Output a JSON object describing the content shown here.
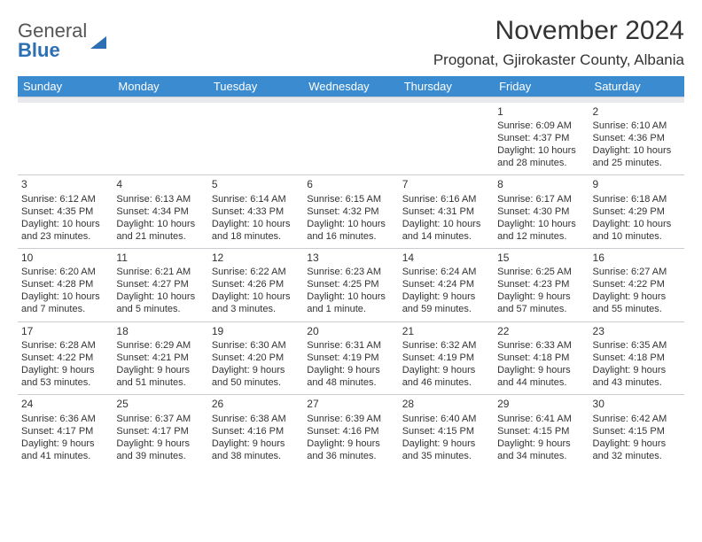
{
  "logo": {
    "top": "General",
    "bottom": "Blue"
  },
  "title": "November 2024",
  "location": "Progonat, Gjirokaster County, Albania",
  "weekdays": [
    "Sunday",
    "Monday",
    "Tuesday",
    "Wednesday",
    "Thursday",
    "Friday",
    "Saturday"
  ],
  "weeks": [
    [
      null,
      null,
      null,
      null,
      null,
      {
        "n": "1",
        "sr": "Sunrise: 6:09 AM",
        "ss": "Sunset: 4:37 PM",
        "d1": "Daylight: 10 hours",
        "d2": "and 28 minutes."
      },
      {
        "n": "2",
        "sr": "Sunrise: 6:10 AM",
        "ss": "Sunset: 4:36 PM",
        "d1": "Daylight: 10 hours",
        "d2": "and 25 minutes."
      }
    ],
    [
      {
        "n": "3",
        "sr": "Sunrise: 6:12 AM",
        "ss": "Sunset: 4:35 PM",
        "d1": "Daylight: 10 hours",
        "d2": "and 23 minutes."
      },
      {
        "n": "4",
        "sr": "Sunrise: 6:13 AM",
        "ss": "Sunset: 4:34 PM",
        "d1": "Daylight: 10 hours",
        "d2": "and 21 minutes."
      },
      {
        "n": "5",
        "sr": "Sunrise: 6:14 AM",
        "ss": "Sunset: 4:33 PM",
        "d1": "Daylight: 10 hours",
        "d2": "and 18 minutes."
      },
      {
        "n": "6",
        "sr": "Sunrise: 6:15 AM",
        "ss": "Sunset: 4:32 PM",
        "d1": "Daylight: 10 hours",
        "d2": "and 16 minutes."
      },
      {
        "n": "7",
        "sr": "Sunrise: 6:16 AM",
        "ss": "Sunset: 4:31 PM",
        "d1": "Daylight: 10 hours",
        "d2": "and 14 minutes."
      },
      {
        "n": "8",
        "sr": "Sunrise: 6:17 AM",
        "ss": "Sunset: 4:30 PM",
        "d1": "Daylight: 10 hours",
        "d2": "and 12 minutes."
      },
      {
        "n": "9",
        "sr": "Sunrise: 6:18 AM",
        "ss": "Sunset: 4:29 PM",
        "d1": "Daylight: 10 hours",
        "d2": "and 10 minutes."
      }
    ],
    [
      {
        "n": "10",
        "sr": "Sunrise: 6:20 AM",
        "ss": "Sunset: 4:28 PM",
        "d1": "Daylight: 10 hours",
        "d2": "and 7 minutes."
      },
      {
        "n": "11",
        "sr": "Sunrise: 6:21 AM",
        "ss": "Sunset: 4:27 PM",
        "d1": "Daylight: 10 hours",
        "d2": "and 5 minutes."
      },
      {
        "n": "12",
        "sr": "Sunrise: 6:22 AM",
        "ss": "Sunset: 4:26 PM",
        "d1": "Daylight: 10 hours",
        "d2": "and 3 minutes."
      },
      {
        "n": "13",
        "sr": "Sunrise: 6:23 AM",
        "ss": "Sunset: 4:25 PM",
        "d1": "Daylight: 10 hours",
        "d2": "and 1 minute."
      },
      {
        "n": "14",
        "sr": "Sunrise: 6:24 AM",
        "ss": "Sunset: 4:24 PM",
        "d1": "Daylight: 9 hours",
        "d2": "and 59 minutes."
      },
      {
        "n": "15",
        "sr": "Sunrise: 6:25 AM",
        "ss": "Sunset: 4:23 PM",
        "d1": "Daylight: 9 hours",
        "d2": "and 57 minutes."
      },
      {
        "n": "16",
        "sr": "Sunrise: 6:27 AM",
        "ss": "Sunset: 4:22 PM",
        "d1": "Daylight: 9 hours",
        "d2": "and 55 minutes."
      }
    ],
    [
      {
        "n": "17",
        "sr": "Sunrise: 6:28 AM",
        "ss": "Sunset: 4:22 PM",
        "d1": "Daylight: 9 hours",
        "d2": "and 53 minutes."
      },
      {
        "n": "18",
        "sr": "Sunrise: 6:29 AM",
        "ss": "Sunset: 4:21 PM",
        "d1": "Daylight: 9 hours",
        "d2": "and 51 minutes."
      },
      {
        "n": "19",
        "sr": "Sunrise: 6:30 AM",
        "ss": "Sunset: 4:20 PM",
        "d1": "Daylight: 9 hours",
        "d2": "and 50 minutes."
      },
      {
        "n": "20",
        "sr": "Sunrise: 6:31 AM",
        "ss": "Sunset: 4:19 PM",
        "d1": "Daylight: 9 hours",
        "d2": "and 48 minutes."
      },
      {
        "n": "21",
        "sr": "Sunrise: 6:32 AM",
        "ss": "Sunset: 4:19 PM",
        "d1": "Daylight: 9 hours",
        "d2": "and 46 minutes."
      },
      {
        "n": "22",
        "sr": "Sunrise: 6:33 AM",
        "ss": "Sunset: 4:18 PM",
        "d1": "Daylight: 9 hours",
        "d2": "and 44 minutes."
      },
      {
        "n": "23",
        "sr": "Sunrise: 6:35 AM",
        "ss": "Sunset: 4:18 PM",
        "d1": "Daylight: 9 hours",
        "d2": "and 43 minutes."
      }
    ],
    [
      {
        "n": "24",
        "sr": "Sunrise: 6:36 AM",
        "ss": "Sunset: 4:17 PM",
        "d1": "Daylight: 9 hours",
        "d2": "and 41 minutes."
      },
      {
        "n": "25",
        "sr": "Sunrise: 6:37 AM",
        "ss": "Sunset: 4:17 PM",
        "d1": "Daylight: 9 hours",
        "d2": "and 39 minutes."
      },
      {
        "n": "26",
        "sr": "Sunrise: 6:38 AM",
        "ss": "Sunset: 4:16 PM",
        "d1": "Daylight: 9 hours",
        "d2": "and 38 minutes."
      },
      {
        "n": "27",
        "sr": "Sunrise: 6:39 AM",
        "ss": "Sunset: 4:16 PM",
        "d1": "Daylight: 9 hours",
        "d2": "and 36 minutes."
      },
      {
        "n": "28",
        "sr": "Sunrise: 6:40 AM",
        "ss": "Sunset: 4:15 PM",
        "d1": "Daylight: 9 hours",
        "d2": "and 35 minutes."
      },
      {
        "n": "29",
        "sr": "Sunrise: 6:41 AM",
        "ss": "Sunset: 4:15 PM",
        "d1": "Daylight: 9 hours",
        "d2": "and 34 minutes."
      },
      {
        "n": "30",
        "sr": "Sunrise: 6:42 AM",
        "ss": "Sunset: 4:15 PM",
        "d1": "Daylight: 9 hours",
        "d2": "and 32 minutes."
      }
    ]
  ]
}
